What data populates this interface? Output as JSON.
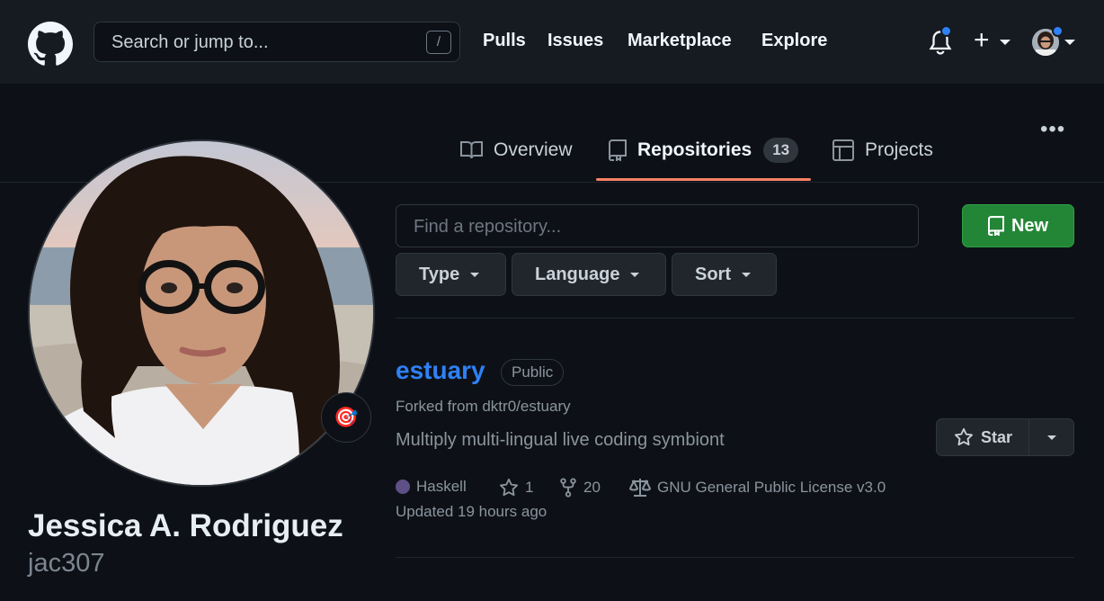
{
  "header": {
    "search_placeholder": "Search or jump to...",
    "search_shortcut": "/",
    "nav": [
      "Pulls",
      "Issues",
      "Marketplace",
      "Explore"
    ],
    "accent_dot_color": "#2f81f7"
  },
  "tabs": {
    "overview": "Overview",
    "repositories": "Repositories",
    "repositories_count": "13",
    "projects": "Projects",
    "active": "repositories",
    "active_underline_color": "#f78166"
  },
  "profile": {
    "name": "Jessica A. Rodriguez",
    "login": "jac307",
    "status_emoji": "🎯"
  },
  "repo_list": {
    "find_placeholder": "Find a repository...",
    "new_label": "New",
    "filters": [
      "Type",
      "Language",
      "Sort"
    ],
    "items": [
      {
        "name": "estuary",
        "visibility": "Public",
        "forked_from": "Forked from dktr0/estuary",
        "description": "Multiply multi-lingual live coding symbiont",
        "star_label": "Star",
        "language": "Haskell",
        "language_color": "#5e5086",
        "stars": "1",
        "forks": "20",
        "license": "GNU General Public License v3.0",
        "updated": "Updated 19 hours ago"
      }
    ]
  }
}
